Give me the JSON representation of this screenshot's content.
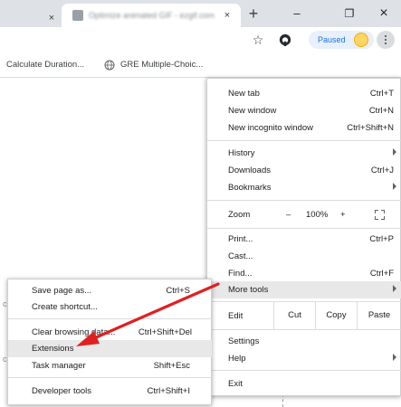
{
  "tabs": {
    "left_close": "×",
    "active_title": "Optimize animated GIF - ezgif.com",
    "active_close": "×",
    "new_tab": "+"
  },
  "window_controls": {
    "minimize": "–",
    "restore": "❐",
    "close": "×"
  },
  "toolbar": {
    "star": "☆",
    "paused_label": "Paused"
  },
  "bookmarks": [
    {
      "label": "Calculate Duration..."
    },
    {
      "label": "GRE Multiple-Choic..."
    }
  ],
  "menu": {
    "new_tab": {
      "label": "New tab",
      "shortcut": "Ctrl+T"
    },
    "new_window": {
      "label": "New window",
      "shortcut": "Ctrl+N"
    },
    "new_incognito": {
      "label": "New incognito window",
      "shortcut": "Ctrl+Shift+N"
    },
    "history": {
      "label": "History"
    },
    "downloads": {
      "label": "Downloads",
      "shortcut": "Ctrl+J"
    },
    "bookmarks": {
      "label": "Bookmarks"
    },
    "zoom": {
      "label": "Zoom",
      "minus": "–",
      "value": "100%",
      "plus": "+"
    },
    "print": {
      "label": "Print...",
      "shortcut": "Ctrl+P"
    },
    "cast": {
      "label": "Cast..."
    },
    "find": {
      "label": "Find...",
      "shortcut": "Ctrl+F"
    },
    "more_tools": {
      "label": "More tools"
    },
    "edit": {
      "label": "Edit",
      "cut": "Cut",
      "copy": "Copy",
      "paste": "Paste"
    },
    "settings": {
      "label": "Settings"
    },
    "help": {
      "label": "Help"
    },
    "exit": {
      "label": "Exit"
    }
  },
  "submenu": {
    "save_page": {
      "label": "Save page as...",
      "shortcut": "Ctrl+S"
    },
    "create_shortcut": {
      "label": "Create shortcut..."
    },
    "clear_browsing": {
      "label": "Clear browsing data...",
      "shortcut": "Ctrl+Shift+Del"
    },
    "extensions": {
      "label": "Extensions"
    },
    "task_manager": {
      "label": "Task manager",
      "shortcut": "Shift+Esc"
    },
    "developer_tools": {
      "label": "Developer tools",
      "shortcut": "Ctrl+Shift+I"
    }
  },
  "page_marks": [
    "c",
    "c"
  ],
  "colors": {
    "arrow": "#e02020",
    "highlight": "#e8e8e8",
    "accent": "#1a73e8"
  }
}
